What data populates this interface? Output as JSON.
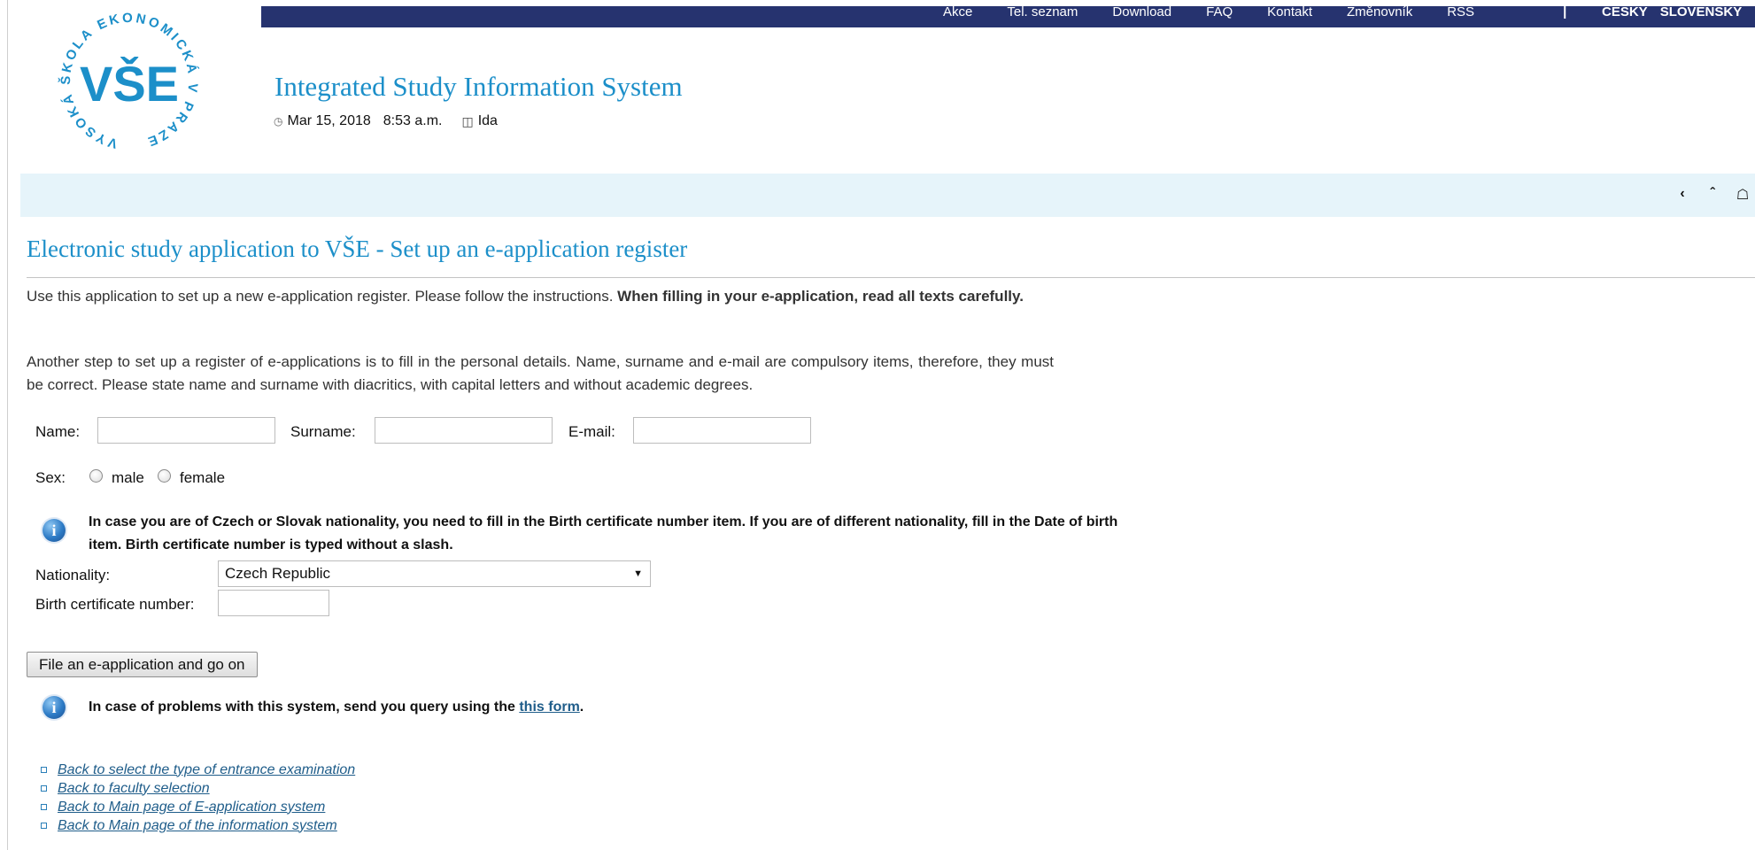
{
  "topnav": {
    "items": [
      "Akce",
      "Tel. seznam",
      "Download",
      "FAQ",
      "Kontakt",
      "Změnovník",
      "RSS"
    ],
    "separator": "|",
    "languages": [
      "ČESKY",
      "SLOVENSKY"
    ]
  },
  "logo": {
    "ring_text": "VYSOKÁ ŠKOLA EKONOMICKÁ V PRAZE",
    "mark": "VŠE"
  },
  "header": {
    "title": "Integrated Study Information System",
    "date": "Mar 15, 2018",
    "time": "8:53 a.m.",
    "user": "Ida"
  },
  "page": {
    "title": "Electronic study application to VŠE - Set up an e-application register",
    "intro_plain": "Use this application to set up a new e-application register. Please follow the instructions.",
    "intro_bold": "When filling in your e-application, read all texts carefully.",
    "personal_info": "Another step to set up a register of e-applications is to fill in the personal details. Name, surname and e-mail are compulsory items, therefore, they must be correct. Please state name and surname with diacritics, with capital letters and without academic degrees."
  },
  "form": {
    "name_label": "Name:",
    "name_value": "",
    "surname_label": "Surname:",
    "surname_value": "",
    "email_label": "E-mail:",
    "email_value": "",
    "sex_label": "Sex:",
    "sex_options": [
      "male",
      "female"
    ],
    "nationality_note": "In case you are of Czech or Slovak nationality, you need to fill in the Birth certificate number item. If you are of different nationality, fill in the Date of birth item. Birth certificate number is typed without a slash.",
    "nationality_label": "Nationality:",
    "nationality_value": "Czech Republic",
    "birth_cert_label": "Birth certificate number:",
    "birth_cert_value": "",
    "submit_label": "File an e-application and go on"
  },
  "help": {
    "text": "In case of problems with this system, send you query using the",
    "link": "this form",
    "suffix": "."
  },
  "links": [
    "Back to select the type of entrance examination",
    "Back to faculty selection",
    "Back to Main page of E-application system",
    "Back to Main page of the information system"
  ],
  "colors": {
    "topbar": "#26336f",
    "accent": "#1c8fc9",
    "band": "#e6f4fa",
    "link": "#1f5d8a"
  },
  "icons": [
    "clock-icon",
    "user-icon",
    "back-icon",
    "up-icon",
    "home-icon",
    "info-icon"
  ]
}
